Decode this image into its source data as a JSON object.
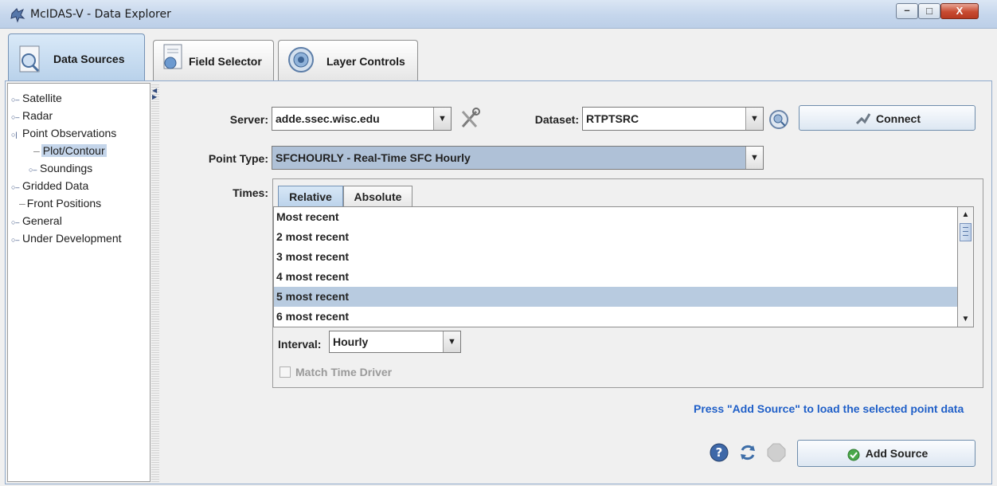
{
  "window": {
    "title": "McIDAS-V - Data Explorer",
    "controls": {
      "minimize": "–",
      "maximize": "□",
      "close": "X"
    }
  },
  "tabs": [
    {
      "label": "Data Sources",
      "icon": "data-sources-icon",
      "active": true
    },
    {
      "label": "Field Selector",
      "icon": "field-selector-icon",
      "active": false
    },
    {
      "label": "Layer Controls",
      "icon": "layer-controls-icon",
      "active": false
    }
  ],
  "tree": {
    "items": [
      {
        "label": "Satellite"
      },
      {
        "label": "Radar"
      },
      {
        "label": "Point Observations"
      },
      {
        "label": "Plot/Contour"
      },
      {
        "label": "Soundings"
      },
      {
        "label": "Gridded Data"
      },
      {
        "label": "Front Positions"
      },
      {
        "label": "General"
      },
      {
        "label": "Under Development"
      }
    ]
  },
  "form": {
    "server": {
      "label": "Server:",
      "value": "adde.ssec.wisc.edu"
    },
    "dataset": {
      "label": "Dataset:",
      "value": "RTPTSRC"
    },
    "connect_label": "Connect",
    "point_type": {
      "label": "Point Type:",
      "value": "SFCHOURLY - Real-Time SFC Hourly"
    },
    "times": {
      "label": "Times:",
      "tabs": [
        "Relative",
        "Absolute"
      ],
      "items": [
        "Most recent",
        "2 most recent",
        "3 most recent",
        "4 most recent",
        "5 most recent",
        "6 most recent"
      ],
      "selected_index": 4,
      "interval_label": "Interval:",
      "interval_value": "Hourly",
      "match_time_driver": "Match Time Driver"
    },
    "hint": "Press \"Add Source\" to load the selected point data",
    "add_source_label": "Add Source"
  },
  "colors": {
    "selection": "#b8cbe0",
    "hint": "#1f5fc8",
    "title_bar": "#c5d6ec"
  }
}
